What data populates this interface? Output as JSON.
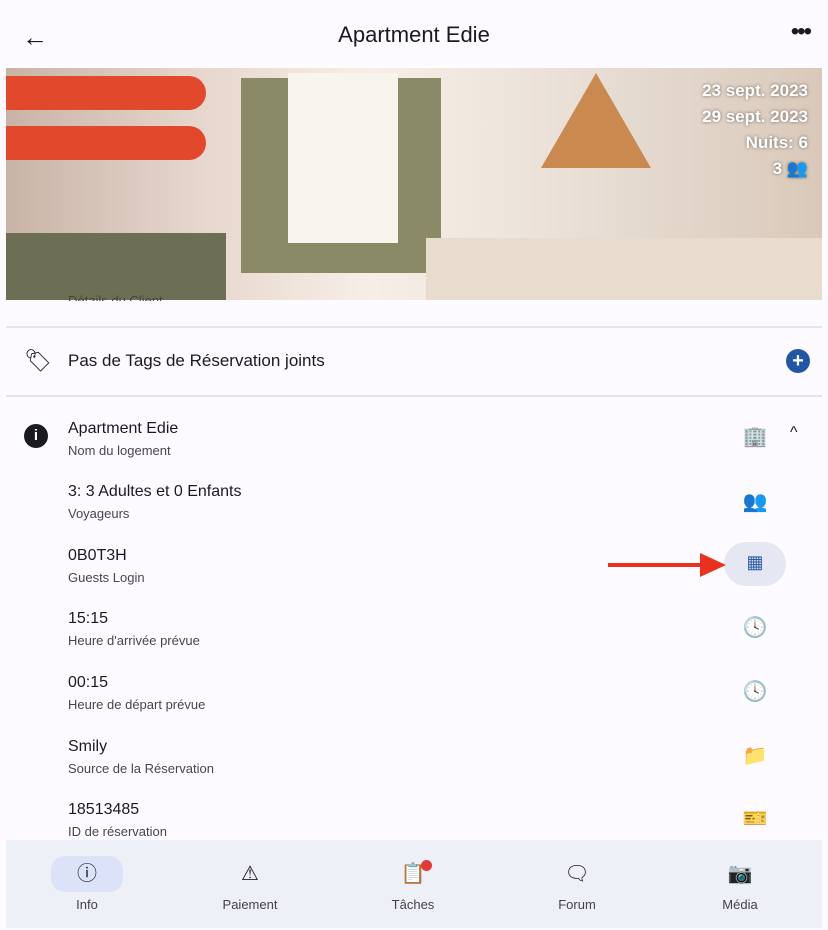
{
  "header": {
    "title": "Apartment Edie",
    "back_icon": "arrow-back-icon",
    "more_icon": "more-horiz-icon"
  },
  "hero": {
    "checkin": "23 sept. 2023",
    "checkout": "29 sept. 2023",
    "nights": "Nuits: 6",
    "guests": "3",
    "guests_icon": "people-icon"
  },
  "peek_label": "Détails du Client",
  "tags": {
    "label": "Pas de Tags de Réservation joints",
    "icon": "tag-icon",
    "add_icon": "add-circle-icon"
  },
  "details": [
    {
      "value": "Apartment Edie",
      "label": "Nom du logement",
      "icon": "apartment-icon"
    },
    {
      "value": "3: 3 Adultes et 0 Enfants",
      "label": "Voyageurs",
      "icon": "people-icon"
    },
    {
      "value": "0B0T3H",
      "label": "Guests Login",
      "icon": "qr-code-icon"
    },
    {
      "value": "15:15",
      "label": "Heure d'arrivée prévue",
      "icon": "clock-icon"
    },
    {
      "value": "00:15",
      "label": "Heure de départ prévue",
      "icon": "clock-icon"
    },
    {
      "value": "Smily",
      "label": "Source de la Réservation",
      "icon": "folder-icon"
    },
    {
      "value": "18513485",
      "label": "ID de réservation",
      "icon": "ticket-icon"
    }
  ],
  "nav": [
    {
      "label": "Info",
      "icon": "info-icon",
      "active": true
    },
    {
      "label": "Paiement",
      "icon": "warning-icon"
    },
    {
      "label": "Tâches",
      "icon": "assignment-icon",
      "badge": true
    },
    {
      "label": "Forum",
      "icon": "chat-icon"
    },
    {
      "label": "Média",
      "icon": "camera-icon"
    }
  ],
  "colors": {
    "accent": "#2456a6",
    "annotation_arrow": "#e8321f",
    "nav_bg": "#eef0f8"
  }
}
